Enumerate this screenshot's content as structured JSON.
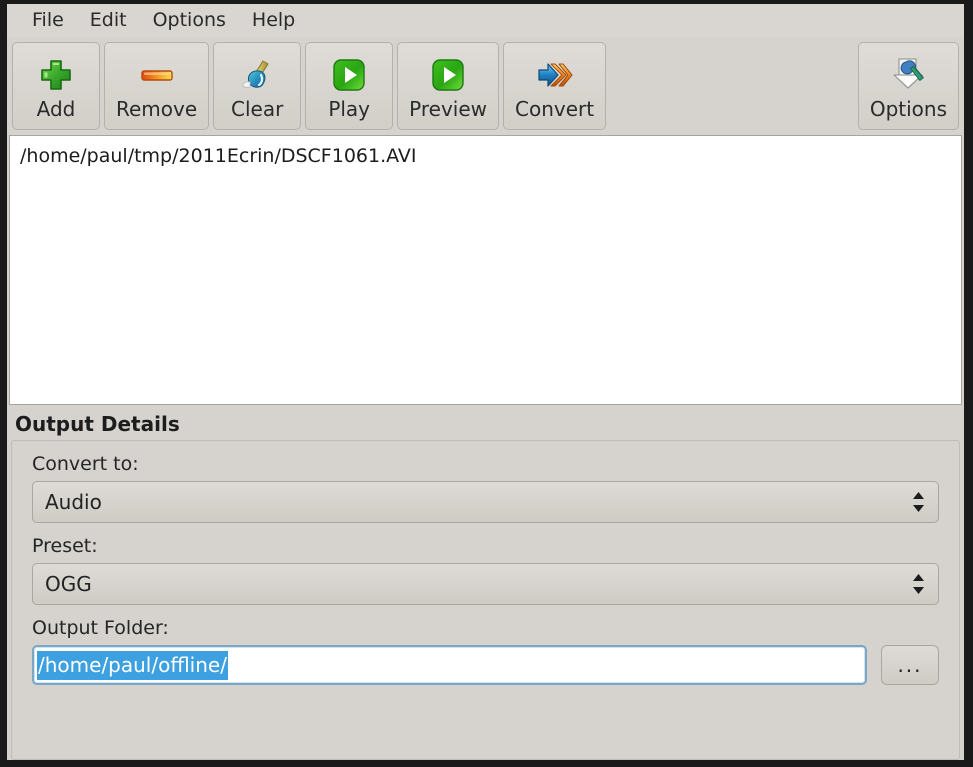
{
  "menubar": {
    "items": [
      {
        "label": "File"
      },
      {
        "label": "Edit"
      },
      {
        "label": "Options"
      },
      {
        "label": "Help"
      }
    ]
  },
  "toolbar": {
    "buttons": [
      {
        "label": "Add",
        "icon": "plus-icon"
      },
      {
        "label": "Remove",
        "icon": "minus-icon"
      },
      {
        "label": "Clear",
        "icon": "brush-icon"
      },
      {
        "label": "Play",
        "icon": "play-icon"
      },
      {
        "label": "Preview",
        "icon": "play-icon"
      },
      {
        "label": "Convert",
        "icon": "convert-arrow-icon"
      }
    ],
    "options_button": {
      "label": "Options",
      "icon": "wrench-document-icon"
    }
  },
  "file_list": {
    "files": [
      {
        "path": "/home/paul/tmp/2011Ecrin/DSCF1061.AVI"
      }
    ]
  },
  "output_details": {
    "title": "Output Details",
    "convert_to": {
      "label": "Convert to:",
      "value": "Audio"
    },
    "preset": {
      "label": "Preset:",
      "value": "OGG"
    },
    "output_folder": {
      "label": "Output Folder:",
      "value": "/home/paul/offline/",
      "browse_label": "..."
    }
  },
  "colors": {
    "window_background": "#d6d3ce",
    "selection_blue": "#3da0e0",
    "focus_border": "#7ba7c4",
    "list_background": "#ffffff",
    "text": "#252525"
  }
}
